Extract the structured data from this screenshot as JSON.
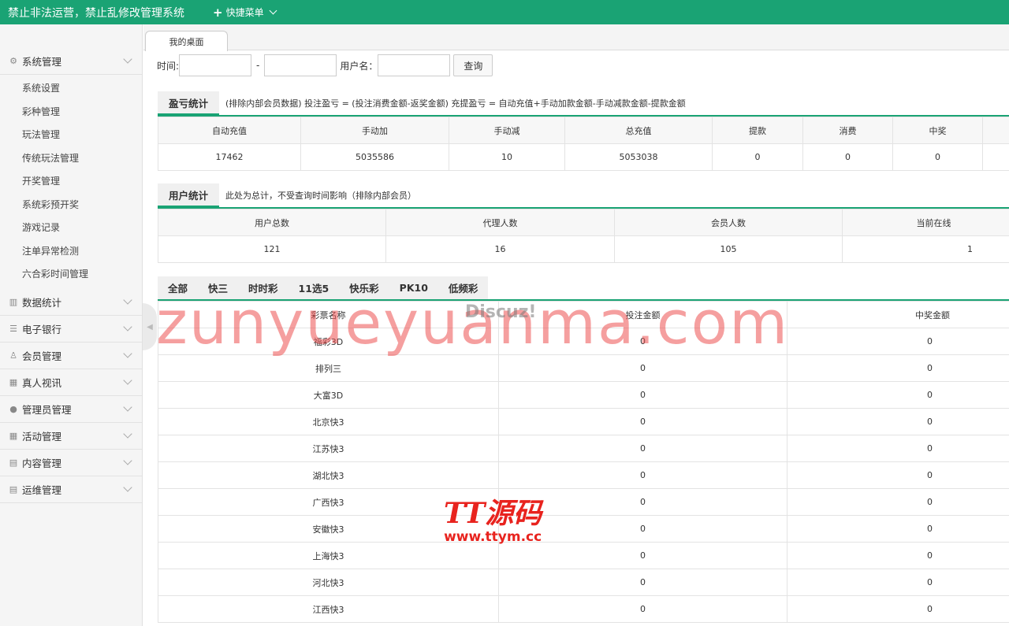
{
  "header": {
    "title": "禁止非法运营，禁止乱修改管理系统",
    "quick_menu": "快捷菜单"
  },
  "sidebar": {
    "sections": [
      {
        "label": "系统管理",
        "icon": "gear-icon",
        "expanded": true,
        "items": [
          "系统设置",
          "彩种管理",
          "玩法管理",
          "传统玩法管理",
          "开奖管理",
          "系统彩预开奖",
          "游戏记录",
          "注单异常检测",
          "六合彩时间管理"
        ]
      },
      {
        "label": "数据统计",
        "icon": "bar-chart-icon"
      },
      {
        "label": "电子银行",
        "icon": "list-icon"
      },
      {
        "label": "会员管理",
        "icon": "user-outline-icon"
      },
      {
        "label": "真人视讯",
        "icon": "gift-icon"
      },
      {
        "label": "管理员管理",
        "icon": "user-icon"
      },
      {
        "label": "活动管理",
        "icon": "gift-icon"
      },
      {
        "label": "内容管理",
        "icon": "document-icon"
      },
      {
        "label": "运维管理",
        "icon": "document-icon"
      }
    ]
  },
  "tabs": [
    {
      "label": "我的桌面"
    }
  ],
  "filter": {
    "time_label": "时间:",
    "dash": "-",
    "user_label": "用户名：",
    "search_button": "查询",
    "time_start": "",
    "time_end": "",
    "username": ""
  },
  "profit": {
    "title": "盈亏统计",
    "note": "(排除内部会员数据)  投注盈亏 = (投注消费金额-返奖金额)     充提盈亏 = 自动充值+手动加款金额-手动减款金额-提款金额",
    "columns": [
      "自动充值",
      "手动加",
      "手动减",
      "总充值",
      "提款",
      "消费",
      "中奖",
      ""
    ],
    "values": [
      "17462",
      "5035586",
      "10",
      "5053038",
      "0",
      "0",
      "0",
      ""
    ]
  },
  "users": {
    "title": "用户统计",
    "note": "此处为总计，不受查询时间影响（排除内部会员）",
    "columns": [
      "用户总数",
      "代理人数",
      "会员人数",
      "当前在线"
    ],
    "values": [
      "121",
      "16",
      "105",
      "1"
    ]
  },
  "lottery": {
    "tabs": [
      "全部",
      "快三",
      "时时彩",
      "11选5",
      "快乐彩",
      "PK10",
      "低频彩"
    ],
    "columns": [
      "彩票名称",
      "投注金额",
      "中奖金额"
    ],
    "rows": [
      [
        "福彩3D",
        "0",
        "0"
      ],
      [
        "排列三",
        "0",
        "0"
      ],
      [
        "大富3D",
        "0",
        "0"
      ],
      [
        "北京快3",
        "0",
        "0"
      ],
      [
        "江苏快3",
        "0",
        "0"
      ],
      [
        "湖北快3",
        "0",
        "0"
      ],
      [
        "广西快3",
        "0",
        "0"
      ],
      [
        "安徽快3",
        "0",
        "0"
      ],
      [
        "上海快3",
        "0",
        "0"
      ],
      [
        "河北快3",
        "0",
        "0"
      ],
      [
        "江西快3",
        "0",
        "0"
      ]
    ]
  },
  "watermarks": {
    "main": "zunyueyuanma.com",
    "discuz": "Discuz!",
    "brand": "TT源码",
    "brand_url": "www.ttym.cc"
  },
  "colors": {
    "accent": "#1aa374"
  }
}
